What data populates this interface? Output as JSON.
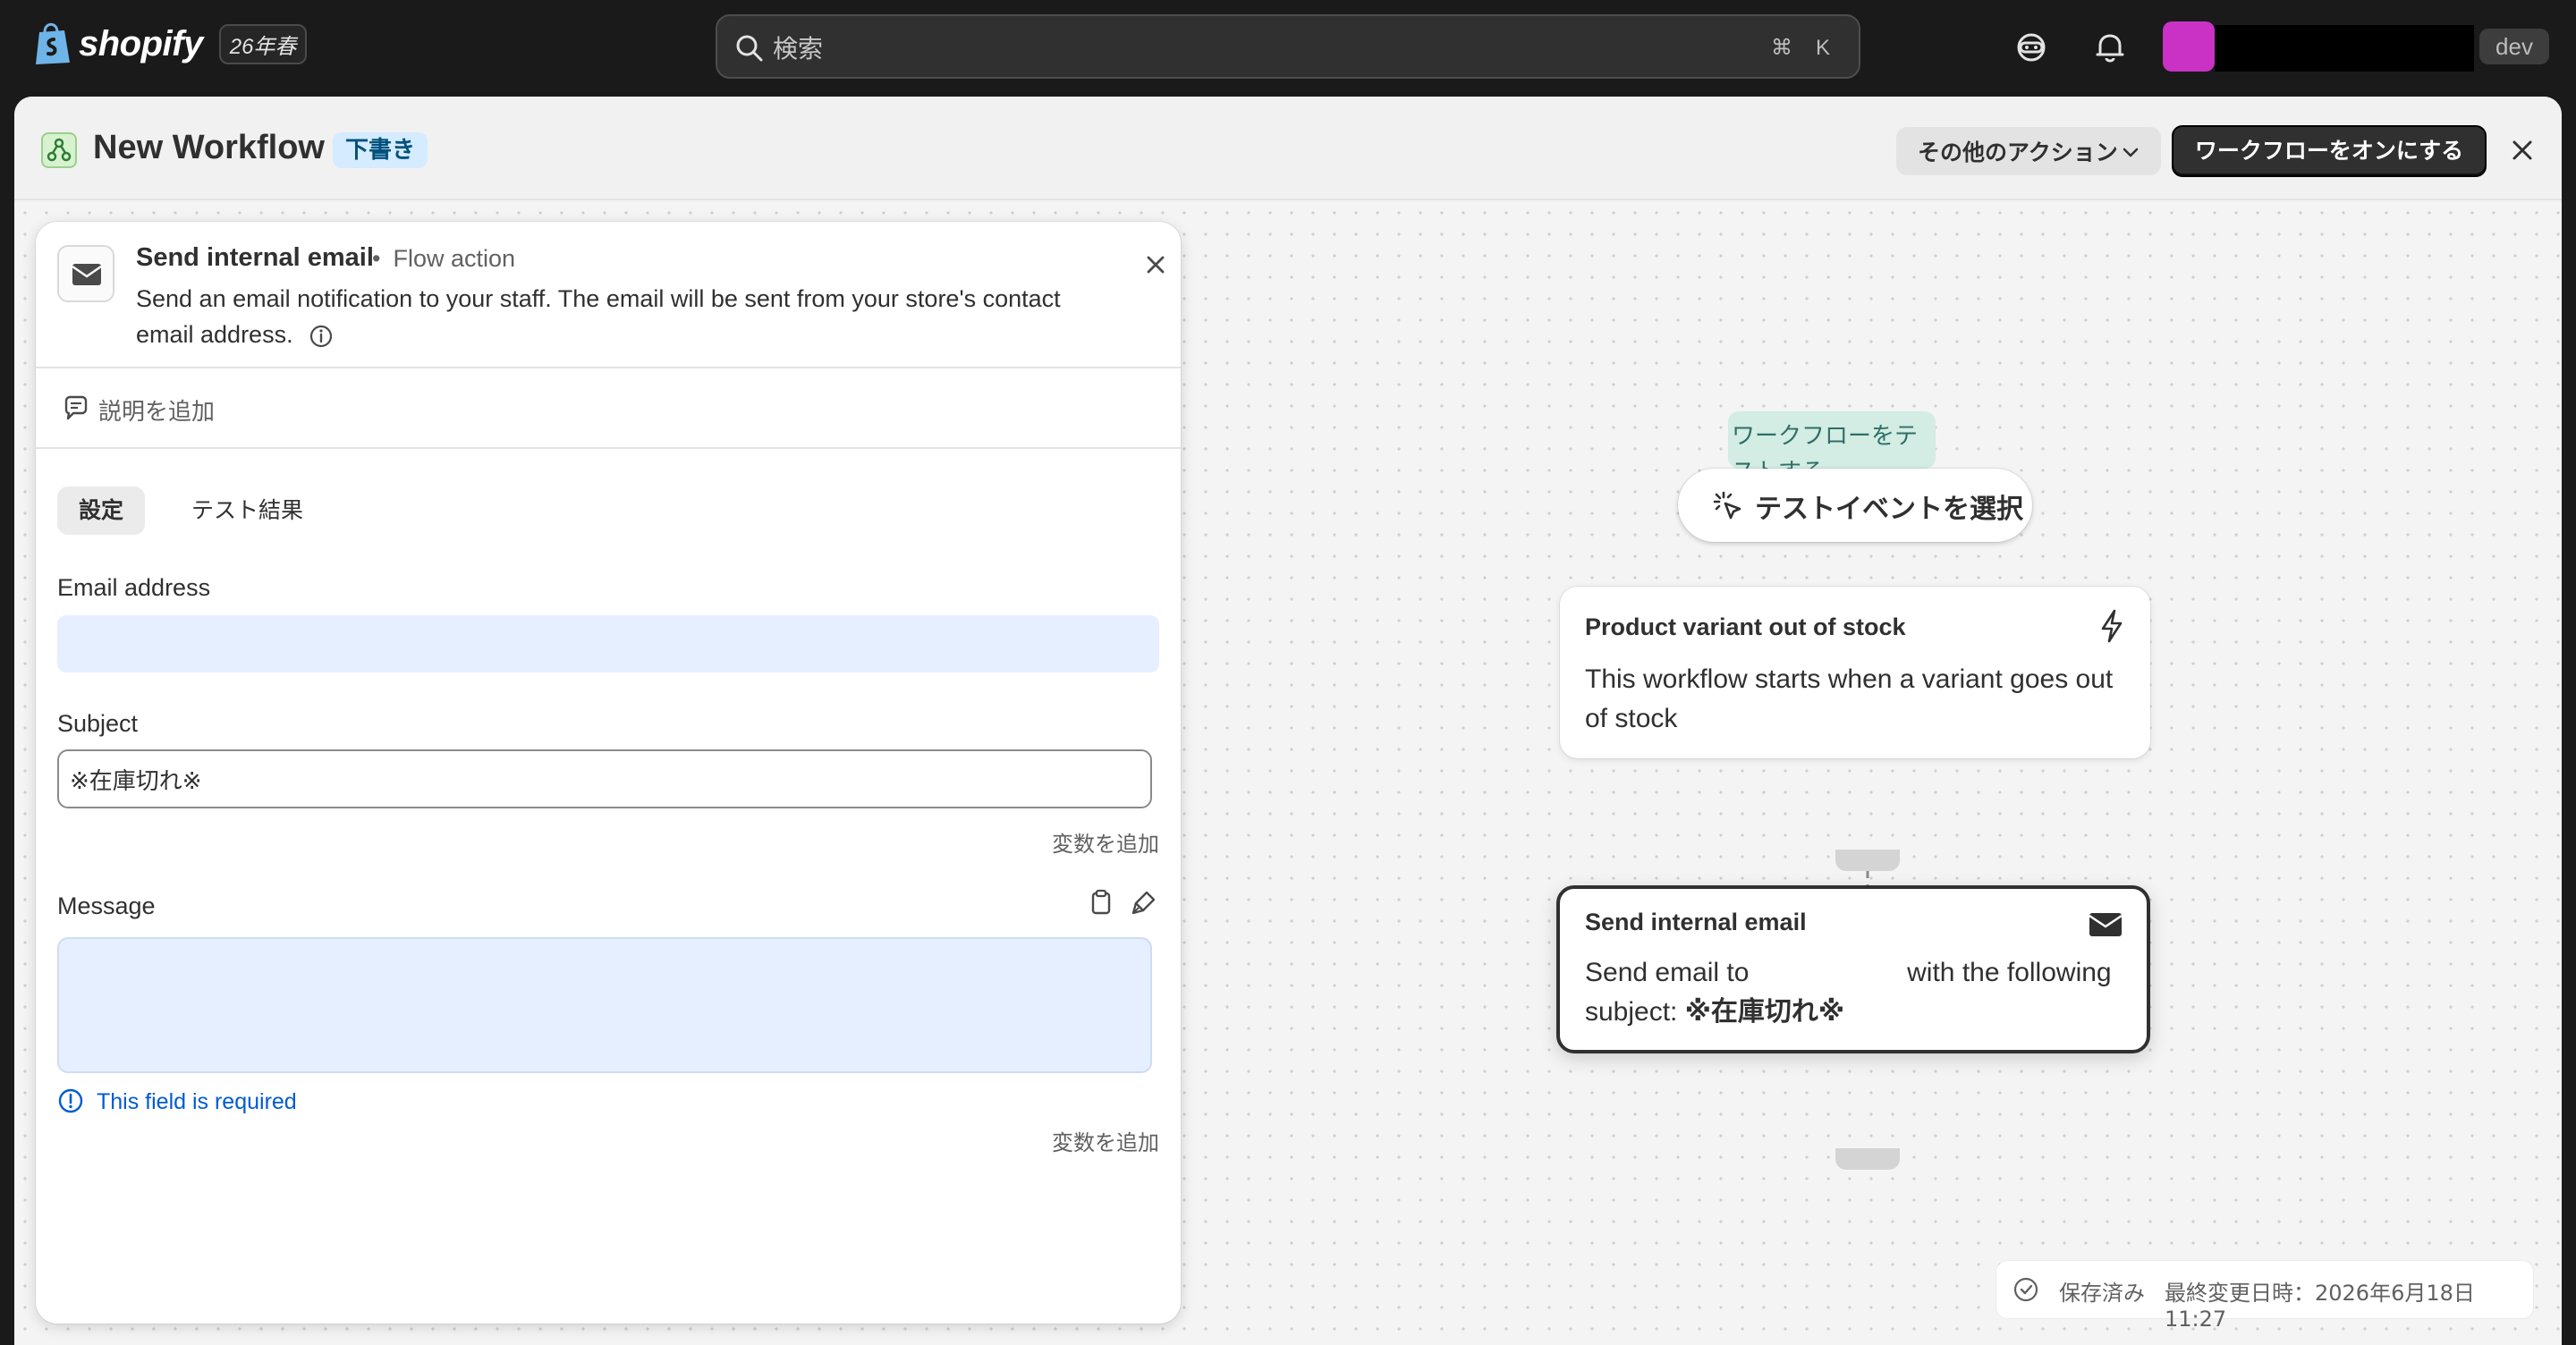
{
  "topbar": {
    "brand": "shopify",
    "edition": "26年春",
    "search_placeholder": "検索",
    "shortcut_cmd": "⌘",
    "shortcut_key": "K",
    "store_badge": "dev"
  },
  "header": {
    "title": "New Workflow",
    "status": "下書き",
    "more_actions": "その他のアクション",
    "turn_on": "ワークフローをオンにする"
  },
  "panel": {
    "title": "Send internal email",
    "kind": "Flow action",
    "description": "Send an email notification to your staff. The email will be sent from your store's contact email address.",
    "add_description": "説明を追加",
    "tabs": [
      {
        "label": "設定",
        "active": true
      },
      {
        "label": "テスト結果",
        "active": false
      }
    ],
    "email": {
      "label": "Email address",
      "value": ""
    },
    "subject": {
      "label": "Subject",
      "value": "※在庫切れ※",
      "add_variable": "変数を追加"
    },
    "message": {
      "label": "Message",
      "value": "",
      "error": "This field is required",
      "add_variable": "変数を追加"
    }
  },
  "canvas": {
    "test_note": "ワークフローをテストする",
    "test_button": "テストイベントを選択",
    "trigger": {
      "title": "Product variant out of stock",
      "body": "This workflow starts when a variant goes out of stock"
    },
    "action": {
      "title": "Send internal email",
      "body_prefix": "Send email to",
      "body_mid": "with the following subject:",
      "subject": "※在庫切れ※"
    },
    "save": {
      "label": "保存済み",
      "time": "最終変更日時：2026年6月18日 11:27"
    }
  },
  "colors": {
    "topbar_bg": "#1a1a1a",
    "avatar": "#c932c4",
    "draft_badge_bg": "#d5ebff",
    "primary_button": "#303030",
    "error": "#005bd3",
    "input_highlight": "#e6efff"
  },
  "icons": {
    "search": "search-icon",
    "support": "support-icon",
    "bell": "bell-icon",
    "mail": "envelope-icon",
    "bolt": "lightning-icon",
    "close": "close-icon",
    "info": "info-icon",
    "clipboard": "clipboard-icon",
    "brush": "brush-icon",
    "check": "check-circle-icon"
  }
}
